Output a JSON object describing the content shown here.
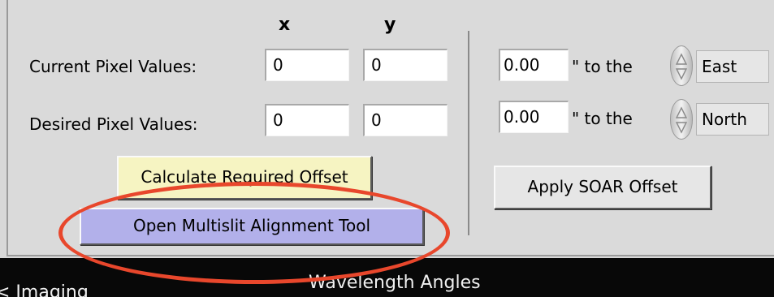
{
  "columns": {
    "x_header": "x",
    "y_header": "y"
  },
  "current_pixel": {
    "label": "Current Pixel Values:",
    "x_value": "0",
    "y_value": "0"
  },
  "desired_pixel": {
    "label": "Desired Pixel Values:",
    "x_value": "0",
    "y_value": "0"
  },
  "buttons": {
    "calculate_offset": "Calculate Required Offset",
    "open_multislit": "Open Multislit Alignment Tool",
    "apply_soar": "Apply SOAR Offset"
  },
  "offsets": {
    "east": {
      "value": "0.00",
      "unit_text": "\" to the",
      "direction": "East"
    },
    "north": {
      "value": "0.00",
      "unit_text": "\" to the",
      "direction": "North"
    }
  },
  "bottom_bar": {
    "left_text": "< Imaging",
    "center_text": "Wavelength Angles"
  },
  "colors": {
    "calculate_button": "#f6f4c2",
    "multislit_button": "#b2b0ea",
    "annotation_oval": "#e8472c",
    "panel_background": "#dadada",
    "bottom_bar": "#080808"
  },
  "icons": {
    "spinner": "up-down-spinner-icon",
    "annotation": "red-oval-highlight"
  }
}
